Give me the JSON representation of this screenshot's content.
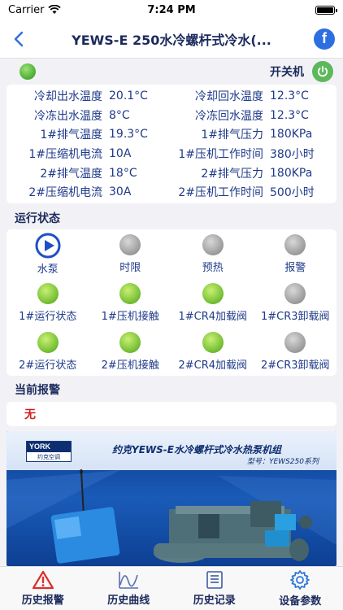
{
  "status_bar": {
    "carrier": "Carrier",
    "time": "7:24 PM"
  },
  "nav": {
    "title": "YEWS-E 250水冷螺杆式冷水(..."
  },
  "power": {
    "label": "开关机",
    "indicator_color": "#54b43a"
  },
  "params": [
    {
      "label1": "冷却出水温度",
      "value1": "20.1°C",
      "label2": "冷却回水温度",
      "value2": "12.3°C"
    },
    {
      "label1": "冷冻出水温度",
      "value1": "8°C",
      "label2": "冷冻回水温度",
      "value2": "12.3°C"
    },
    {
      "label1": "1#排气温度",
      "value1": "19.3°C",
      "label2": "1#排气压力",
      "value2": "180KPa"
    },
    {
      "label1": "1#压缩机电流",
      "value1": "10A",
      "label2": "1#压机工作时间",
      "value2": "380小时"
    },
    {
      "label1": "2#排气温度",
      "value1": "18°C",
      "label2": "2#排气压力",
      "value2": "180KPa"
    },
    {
      "label1": "2#压缩机电流",
      "value1": "30A",
      "label2": "2#压机工作时间",
      "value2": "500小时"
    }
  ],
  "run_status": {
    "title": "运行状态",
    "items": [
      {
        "label": "水泵",
        "state": "play"
      },
      {
        "label": "时限",
        "state": "gray"
      },
      {
        "label": "预热",
        "state": "gray"
      },
      {
        "label": "报警",
        "state": "gray"
      },
      {
        "label": "1#运行状态",
        "state": "green"
      },
      {
        "label": "1#压机接触",
        "state": "green"
      },
      {
        "label": "1#CR4加载阀",
        "state": "green"
      },
      {
        "label": "1#CR3卸载阀",
        "state": "gray"
      },
      {
        "label": "2#运行状态",
        "state": "green"
      },
      {
        "label": "2#压机接触",
        "state": "green"
      },
      {
        "label": "2#CR4加载阀",
        "state": "green"
      },
      {
        "label": "2#CR3卸载阀",
        "state": "gray"
      }
    ]
  },
  "current_alarm": {
    "title": "当前报警",
    "value": "无"
  },
  "banner": {
    "logo": "YORK",
    "logo_sub": "约克空调",
    "title": "约克YEWS-E水冷螺杆式冷水热泵机组",
    "subtitle": "型号：YEWS250系列"
  },
  "tabs": [
    {
      "label": "历史报警",
      "icon": "warning-icon"
    },
    {
      "label": "历史曲线",
      "icon": "curve-icon"
    },
    {
      "label": "历史记录",
      "icon": "document-icon"
    },
    {
      "label": "设备参数",
      "icon": "gear-icon"
    }
  ]
}
